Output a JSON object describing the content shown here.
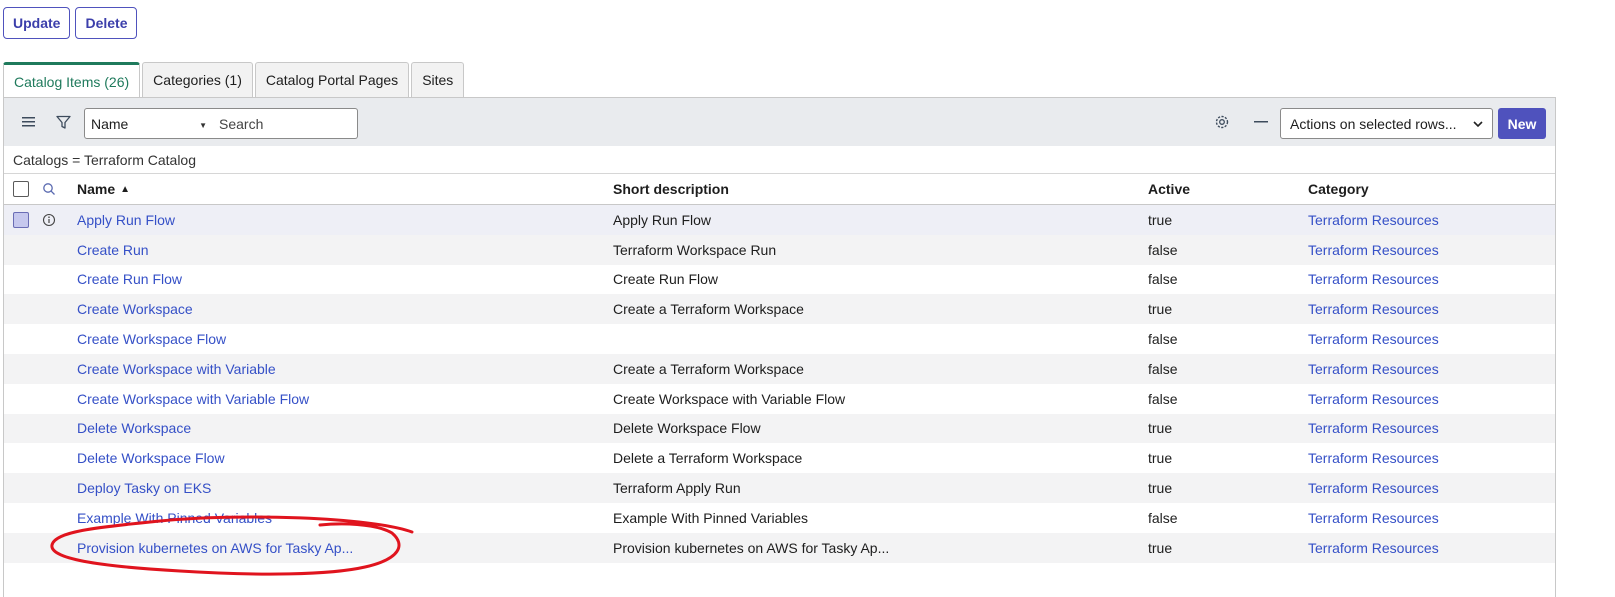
{
  "top_buttons": {
    "update": "Update",
    "delete": "Delete"
  },
  "tabs": [
    {
      "label": "Catalog Items (26)",
      "active": true
    },
    {
      "label": "Categories (1)",
      "active": false
    },
    {
      "label": "Catalog Portal Pages",
      "active": false
    },
    {
      "label": "Sites",
      "active": false
    }
  ],
  "toolbar": {
    "menu_icon": "hamburger-icon",
    "filter_icon": "funnel-icon",
    "field_select": "Name",
    "search_placeholder": "Search",
    "settings_icon": "gear-icon",
    "collapse_icon": "minus-icon",
    "actions_select": "Actions on selected rows...",
    "new_label": "New"
  },
  "filter": {
    "text": "Catalogs = Terraform Catalog"
  },
  "columns": {
    "name": "Name",
    "sort_indicator": "▲",
    "short_description": "Short description",
    "active": "Active",
    "category": "Category"
  },
  "rows": [
    {
      "name": "Apply Run Flow",
      "description": "Apply Run Flow",
      "active": "true",
      "category": "Terraform Resources"
    },
    {
      "name": "Create Run",
      "description": "Terraform Workspace Run",
      "active": "false",
      "category": "Terraform Resources"
    },
    {
      "name": "Create Run Flow",
      "description": "Create Run Flow",
      "active": "false",
      "category": "Terraform Resources"
    },
    {
      "name": "Create Workspace",
      "description": "Create a Terraform Workspace",
      "active": "true",
      "category": "Terraform Resources"
    },
    {
      "name": "Create Workspace Flow",
      "description": "",
      "active": "false",
      "category": "Terraform Resources"
    },
    {
      "name": "Create Workspace with Variable",
      "description": "Create a Terraform Workspace",
      "active": "false",
      "category": "Terraform Resources"
    },
    {
      "name": "Create Workspace with Variable Flow",
      "description": "Create Workspace with Variable Flow",
      "active": "false",
      "category": "Terraform Resources"
    },
    {
      "name": "Delete Workspace",
      "description": "Delete Workspace Flow",
      "active": "true",
      "category": "Terraform Resources"
    },
    {
      "name": "Delete Workspace Flow",
      "description": "Delete a Terraform Workspace",
      "active": "true",
      "category": "Terraform Resources"
    },
    {
      "name": "Deploy Tasky on EKS",
      "description": "Terraform Apply Run",
      "active": "true",
      "category": "Terraform Resources"
    },
    {
      "name": "Example With Pinned Variables",
      "description": "Example With Pinned Variables",
      "active": "false",
      "category": "Terraform Resources"
    },
    {
      "name": "Provision kubernetes on AWS for Tasky Ap...",
      "description": "Provision kubernetes on AWS for Tasky Ap...",
      "active": "true",
      "category": "Terraform Resources"
    }
  ],
  "colors": {
    "primary": "#4f52bd",
    "link": "#3550c7",
    "active_tab": "#1f7a5c",
    "annotation": "#e0141e"
  }
}
